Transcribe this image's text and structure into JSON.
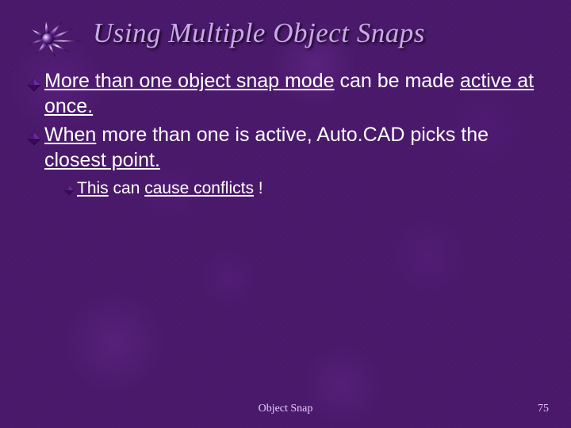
{
  "title": "Using Multiple Object Snaps",
  "bullets": [
    {
      "level": 1,
      "segments": [
        {
          "text": "More than one object snap mode",
          "underline": true
        },
        {
          "text": " can be made ",
          "underline": false
        },
        {
          "text": "active at once.",
          "underline": true
        }
      ]
    },
    {
      "level": 1,
      "segments": [
        {
          "text": "When",
          "underline": true
        },
        {
          "text": " more than one is active, Auto.CAD picks the ",
          "underline": false
        },
        {
          "text": "closest point.",
          "underline": true
        }
      ]
    },
    {
      "level": 2,
      "segments": [
        {
          "text": "This",
          "underline": true
        },
        {
          "text": " can ",
          "underline": false
        },
        {
          "text": "cause conflicts",
          "underline": true
        },
        {
          "text": " !",
          "underline": false
        }
      ]
    }
  ],
  "footer": "Object Snap",
  "page_number": "75",
  "colors": {
    "title": "#c9a8e8",
    "body_text": "#ffffff",
    "footer_text": "#e6c9ff",
    "bullet_fill": "#3a0a5a",
    "background_base": "#4a1a6a"
  },
  "icons": {
    "title_decoration": "starburst-icon",
    "level1_bullet": "diamond-bullet-icon",
    "level2_bullet": "diamond-bullet-small-icon"
  }
}
